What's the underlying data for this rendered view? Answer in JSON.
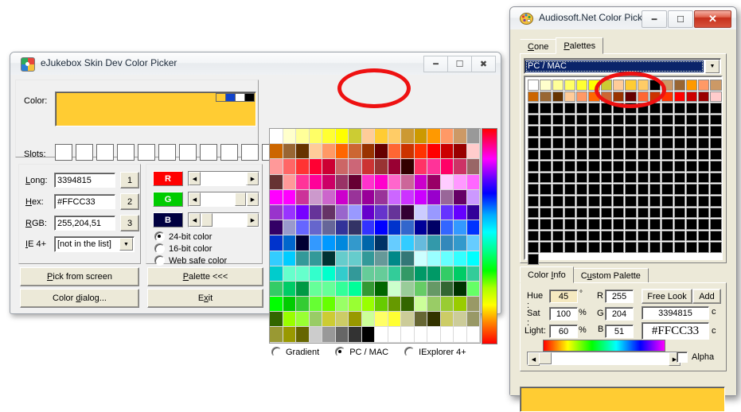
{
  "left_window": {
    "title": "eJukebox Skin Dev Color Picker",
    "icon": "palette-icon",
    "caption_buttons": [
      "minimize",
      "maximize",
      "close"
    ],
    "color_label": "Color:",
    "color_value_hex": "#FFCC33",
    "mini_swatches": [
      "#FFCC33",
      "#1144CC",
      "#FFFFFF",
      "#000000"
    ],
    "slots_label": "Slots:",
    "slot_count": 11,
    "info": {
      "long_label": "Long:",
      "long_value": "3394815",
      "long_button": "1",
      "hex_label": "Hex:",
      "hex_value": "#FFCC33",
      "hex_button": "2",
      "rgb_label": "RGB:",
      "rgb_value": "255,204,51",
      "rgb_button": "3",
      "ie_label": "IE 4+",
      "ie_value": "[not in the list]"
    },
    "channels": [
      {
        "name": "R",
        "value": 255,
        "pct": 100,
        "bg": "#ff0000",
        "fg": "#ffffff"
      },
      {
        "name": "G",
        "value": 204,
        "pct": 80,
        "bg": "#00cc00",
        "fg": "#ffffff"
      },
      {
        "name": "B",
        "value": 51,
        "pct": 20,
        "bg": "#000040",
        "fg": "#ffffff"
      }
    ],
    "depth_options": [
      {
        "label": "24-bit color",
        "selected": true
      },
      {
        "label": "16-bit color",
        "selected": false
      },
      {
        "label": "Web safe color",
        "selected": false
      }
    ],
    "buttons": {
      "pick_from_screen": "Pick from screen",
      "color_dialog": "Color dialog...",
      "palette": "Palette <<<",
      "exit": "Exit"
    },
    "palette_modes": [
      {
        "label": "Gradient",
        "selected": false
      },
      {
        "label": "PC / MAC",
        "selected": true
      },
      {
        "label": "IExplorer 4+",
        "selected": false
      }
    ],
    "grid_columns": 16,
    "grid_rows": 14,
    "grid_colors": [
      "#ffffff",
      "#ffffcc",
      "#ffff99",
      "#ffff66",
      "#ffff33",
      "#ffff00",
      "#cccc33",
      "#ffcc99",
      "#ffcc33",
      "#ffcc66",
      "#cc9933",
      "#cc9900",
      "#ff9900",
      "#ff9966",
      "#cc9966",
      "#999999",
      "#cc6600",
      "#996633",
      "#663300",
      "#ffcc99",
      "#ff9966",
      "#ff6600",
      "#cc6633",
      "#993300",
      "#660000",
      "#ff6633",
      "#cc3300",
      "#ff3300",
      "#ff0000",
      "#cc0000",
      "#990000",
      "#ffcccc",
      "#ff9999",
      "#ff6666",
      "#ff3333",
      "#ff0033",
      "#cc0033",
      "#cc6666",
      "#cc6677",
      "#cc3333",
      "#993333",
      "#990033",
      "#330000",
      "#ff3366",
      "#ff3399",
      "#ff0066",
      "#cc3366",
      "#996666",
      "#663333",
      "#ff9999",
      "#ff3399",
      "#ff0099",
      "#cc0066",
      "#993366",
      "#660033",
      "#ff33cc",
      "#ff00cc",
      "#ff66cc",
      "#cc6699",
      "#cc00cc",
      "#990066",
      "#ffccff",
      "#ff99ff",
      "#ff66ff",
      "#ff00ff",
      "#ff00ff",
      "#cc3399",
      "#cc99cc",
      "#cc66cc",
      "#cc00cc",
      "#993399",
      "#990099",
      "#993399",
      "#cc66ff",
      "#cc33ff",
      "#cc00ff",
      "#9900cc",
      "#996699",
      "#660066",
      "#cc99ff",
      "#9933cc",
      "#9933ff",
      "#7700ff",
      "#663399",
      "#663366",
      "#9966cc",
      "#9999ff",
      "#6600cc",
      "#6633cc",
      "#663399",
      "#330033",
      "#ccccff",
      "#9999ff",
      "#6633ff",
      "#6600ff",
      "#330099",
      "#330066",
      "#9999cc",
      "#6666ff",
      "#6666cc",
      "#666699",
      "#333399",
      "#333366",
      "#3333ff",
      "#0000ff",
      "#0033cc",
      "#3366cc",
      "#000099",
      "#000066",
      "#3366ff",
      "#3399ff",
      "#0033ff",
      "#0033cc",
      "#0066cc",
      "#000033",
      "#3399ff",
      "#0099ff",
      "#0088dd",
      "#3399cc",
      "#0066aa",
      "#003366",
      "#66ccff",
      "#33ccff",
      "#66bbdd",
      "#3399aa",
      "#3388bb",
      "#3399cc",
      "#66ccff",
      "#33ccff",
      "#00ccff",
      "#339999",
      "#339999",
      "#003333",
      "#66cccc",
      "#66cccc",
      "#339999",
      "#669999",
      "#008888",
      "#337777",
      "#ccffff",
      "#99ffff",
      "#66ffff",
      "#33ffff",
      "#00ffff",
      "#00cccc",
      "#66ffcc",
      "#66ffcc",
      "#33ffcc",
      "#00ffcc",
      "#33cccc",
      "#339999",
      "#66cc99",
      "#66cc99",
      "#33cc99",
      "#339966",
      "#009966",
      "#009966",
      "#33cc66",
      "#00cc66",
      "#33cc99",
      "#33cc66",
      "#00cc66",
      "#009944",
      "#66ff99",
      "#66ff99",
      "#33ff99",
      "#00ff99",
      "#339933",
      "#006600",
      "#ccffcc",
      "#99cc99",
      "#66cc66",
      "#669966",
      "#336633",
      "#003300",
      "#66ff66",
      "#00ff00",
      "#00cc00",
      "#33cc33",
      "#66ff33",
      "#66ff00",
      "#99ff66",
      "#99ff33",
      "#99ff00",
      "#66cc00",
      "#669900",
      "#336600",
      "#ccff99",
      "#99cc66",
      "#99cc33",
      "#99cc00",
      "#999966",
      "#336600",
      "#99ff00",
      "#99ff33",
      "#99cc66",
      "#cccc33",
      "#cccc66",
      "#999900",
      "#ccff99",
      "#ffff66",
      "#ffff33",
      "#cccc99",
      "#666633",
      "#333300",
      "#cccc66",
      "#cccc99",
      "#999966",
      "#999933",
      "#999900",
      "#666600",
      "#cccccc",
      "#999999",
      "#666666",
      "#333333",
      "#000000",
      "#ffffff",
      "#ffffff",
      "#ffffff",
      "#ffffff",
      "#ffffff",
      "#ffffff",
      "#ffffff",
      "#ffffff"
    ]
  },
  "right_window": {
    "title": "Audiosoft.Net Color Pick...",
    "icon": "palette-icon",
    "caption_buttons": [
      "minimize",
      "maximize",
      "close"
    ],
    "tabs": [
      {
        "label": "Cone",
        "active": false
      },
      {
        "label": "Palettes",
        "active": true
      }
    ],
    "palette_combo_value": "PC / MAC",
    "grid_columns": 16,
    "grid_rows": 15,
    "grid_colors": [
      "#ffffff",
      "#ffffcc",
      "#ffff99",
      "#ffff66",
      "#ffff33",
      "#ffff00",
      "#cccc33",
      "#ffcc99",
      "#ffcc33",
      "#ffcc66",
      "#000000",
      "#cc9966",
      "#996633",
      "#ff9900",
      "#ff9966",
      "#cc9966",
      "#cc6600",
      "#996633",
      "#663300",
      "#ffcc99",
      "#ff9966",
      "#ff6600",
      "#cc6633",
      "#993300",
      "#660000",
      "#ff6633",
      "#cc3300",
      "#ff3300",
      "#ff0000",
      "#cc0000",
      "#990000",
      "#ffcccc"
    ],
    "info_tabs": [
      {
        "label": "Color Info",
        "active": true
      },
      {
        "label": "Custom Palette",
        "active": false
      }
    ],
    "hsl": {
      "hue_label": "Hue :",
      "hue_value": "45",
      "hue_unit": "°",
      "sat_label": "Sat :",
      "sat_value": "100",
      "sat_unit": "%",
      "light_label": "Light:",
      "light_value": "60",
      "light_unit": "%"
    },
    "rgb": {
      "r_label": "R",
      "r_value": "255",
      "g_label": "G",
      "g_value": "204",
      "b_label": "B",
      "b_value": "51"
    },
    "buttons": {
      "free_look": "Free Look",
      "add": "Add"
    },
    "long_value": "3394815",
    "long_suffix": "c",
    "hex_value": "#FFCC33",
    "hex_suffix": "c",
    "alpha_label": "Alpha",
    "alpha_checked": false,
    "preview_color": "#FFCC33"
  },
  "annotations": {
    "circle_color": "#ee1111",
    "circles": [
      {
        "name": "left-palette-highlight"
      },
      {
        "name": "right-palette-highlight"
      }
    ]
  }
}
